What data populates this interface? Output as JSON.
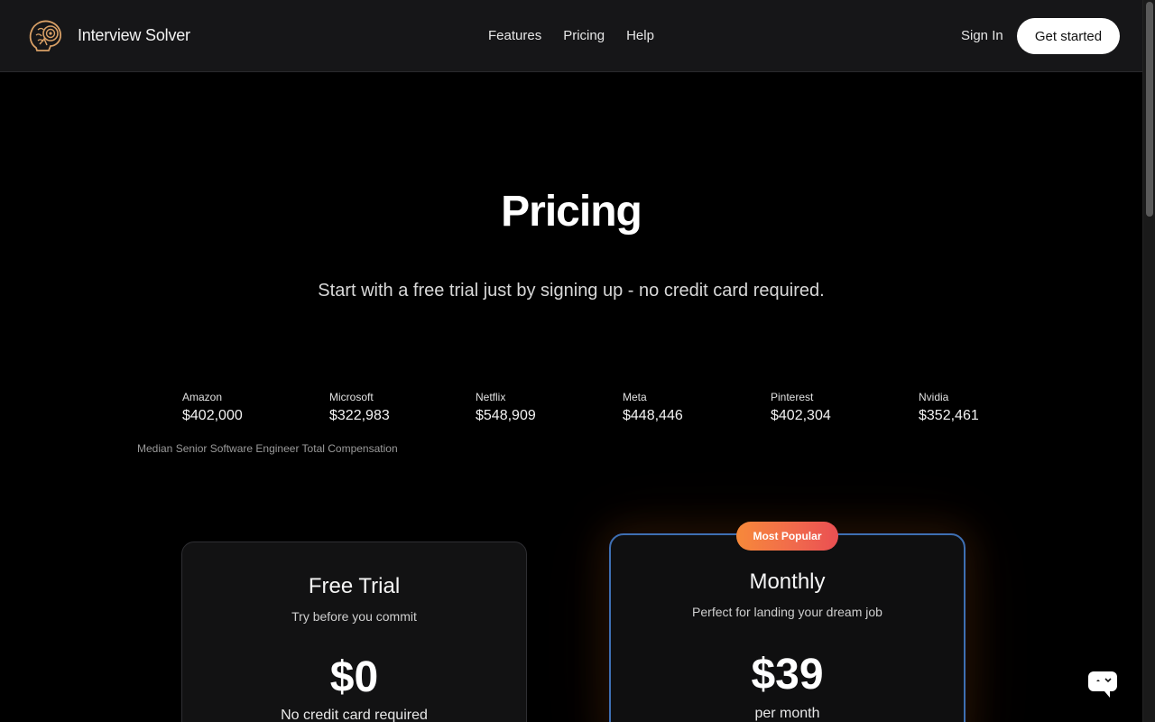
{
  "header": {
    "brand_name": "Interview Solver",
    "nav": [
      {
        "label": "Features"
      },
      {
        "label": "Pricing"
      },
      {
        "label": "Help"
      }
    ],
    "signin_label": "Sign In",
    "cta_label": "Get started"
  },
  "hero": {
    "title": "Pricing",
    "subtitle": "Start with a free trial just by signing up - no credit card required."
  },
  "compensation": {
    "items": [
      {
        "company": "Amazon",
        "value": "$402,000"
      },
      {
        "company": "Microsoft",
        "value": "$322,983"
      },
      {
        "company": "Netflix",
        "value": "$548,909"
      },
      {
        "company": "Meta",
        "value": "$448,446"
      },
      {
        "company": "Pinterest",
        "value": "$402,304"
      },
      {
        "company": "Nvidia",
        "value": "$352,461"
      }
    ],
    "caption": "Median Senior Software Engineer Total Compensation"
  },
  "plans": {
    "free": {
      "title": "Free Trial",
      "description": "Try before you commit",
      "price": "$0",
      "note": "No credit card required"
    },
    "monthly": {
      "badge": "Most Popular",
      "title": "Monthly",
      "description": "Perfect for landing your dream job",
      "price": "$39",
      "note": "per month"
    }
  },
  "colors": {
    "background": "#000000",
    "header_bg": "#161618",
    "badge_gradient_start": "#f7893a",
    "badge_gradient_end": "#ea4f52",
    "monthly_border": "#3e6fb3"
  },
  "icons": {
    "logo": "brain-target-logo",
    "chat": "chat-bubble-icon"
  }
}
